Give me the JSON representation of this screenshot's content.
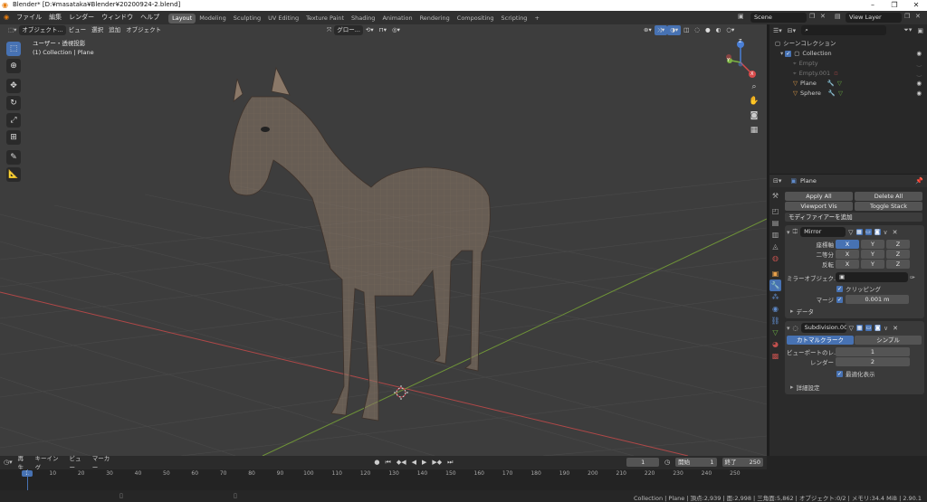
{
  "window": {
    "title": "Blender* [D:¥masataka¥Blender¥20200924-2.blend]",
    "minimize": "–",
    "maximize": "❐",
    "close": "✕"
  },
  "menu": [
    "ファイル",
    "編集",
    "レンダー",
    "ウィンドウ",
    "ヘルプ"
  ],
  "workspaces": [
    "Layout",
    "Modeling",
    "Sculpting",
    "UV Editing",
    "Texture Paint",
    "Shading",
    "Animation",
    "Rendering",
    "Compositing",
    "Scripting"
  ],
  "workspace_add": "+",
  "scene": {
    "name": "Scene",
    "view_layer": "View Layer"
  },
  "viewport": {
    "mode": "オブジェクト...",
    "menus": [
      "ビュー",
      "選択",
      "追加",
      "オブジェクト"
    ],
    "transform_orientation": "グロー...",
    "info_line1": "ユーザー・透視投影",
    "info_line2": "(1) Collection | Plane",
    "gizmo": {
      "x": "X",
      "y": "Y",
      "z": "Z"
    }
  },
  "outliner": {
    "root": "シーンコレクション",
    "collection": "Collection",
    "items": [
      {
        "name": "Empty",
        "dim": true
      },
      {
        "name": "Empty.001",
        "dim": true
      },
      {
        "name": "Plane",
        "dim": false
      },
      {
        "name": "Sphere",
        "dim": false
      }
    ]
  },
  "properties": {
    "object_name": "Plane",
    "apply_all": "Apply All",
    "delete_all": "Delete All",
    "viewport_vis": "Viewport Vis",
    "toggle_stack": "Toggle Stack",
    "add_modifier": "モディファイアーを追加",
    "mirror": {
      "name": "Mirror",
      "axis_label": "座標軸",
      "bisect_label": "二等分",
      "flip_label": "反転",
      "x": "X",
      "y": "Y",
      "z": "Z",
      "mirror_object_label": "ミラーオブジェク...",
      "clipping_label": "クリッピング",
      "merge_label": "マージ",
      "merge_value": "0.001 m",
      "data_label": "データ"
    },
    "subdivision": {
      "name": "Subdivision.001",
      "catmull": "カトマルクラーク",
      "simple": "シンプル",
      "viewport_levels_label": "ビューポートのレ...",
      "viewport_levels_value": "1",
      "render_label": "レンダー",
      "render_value": "2",
      "optimal_display_label": "最適化表示",
      "advanced_label": "詳細設定"
    }
  },
  "timeline": {
    "playback": "再生",
    "keying": "キーイング",
    "view": "ビュー",
    "marker": "マーカー",
    "current_frame": "1",
    "start_label": "開始",
    "start_value": "1",
    "end_label": "終了",
    "end_value": "250",
    "ticks": [
      "1",
      "10",
      "20",
      "30",
      "40",
      "50",
      "60",
      "70",
      "80",
      "90",
      "100",
      "110",
      "120",
      "130",
      "140",
      "150",
      "160",
      "170",
      "180",
      "190",
      "200",
      "210",
      "220",
      "230",
      "240",
      "250"
    ]
  },
  "status": "Collection | Plane | 頂点:2,939 | 面:2,998 | 三角面:5,862 | オブジェクト:0/2 | メモリ:34.4 MiB | 2.90.1",
  "colors": {
    "accent": "#4772b3",
    "x_axis": "#c14a4a",
    "y_axis": "#7a9a3a"
  }
}
